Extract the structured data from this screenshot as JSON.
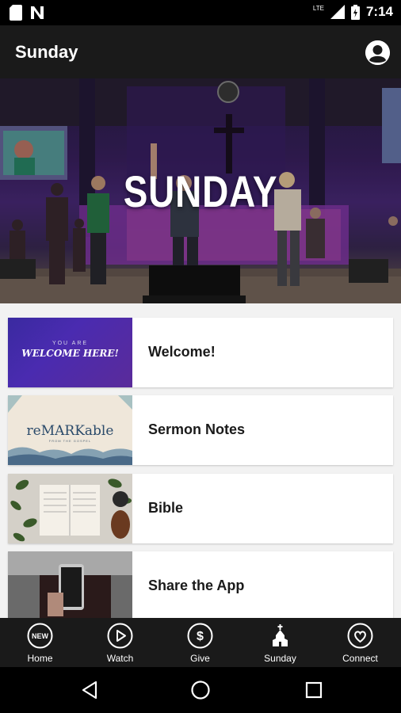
{
  "status_bar": {
    "time": "7:14",
    "network": "LTE",
    "icons": [
      "sd-card-icon",
      "n-logo-icon",
      "signal-icon",
      "battery-icon"
    ]
  },
  "app_bar": {
    "title": "Sunday",
    "profile_icon": "account-circle-icon"
  },
  "hero": {
    "title": "SUNDAY"
  },
  "cards": [
    {
      "label": "Welcome!",
      "thumb_line1": "YOU ARE",
      "thumb_line2": "WELCOME HERE!"
    },
    {
      "label": "Sermon Notes",
      "thumb_line1": "reMARKable",
      "thumb_line2": "FROM THE GOSPEL"
    },
    {
      "label": "Bible"
    },
    {
      "label": "Share the App"
    }
  ],
  "bottom_nav": {
    "items": [
      {
        "label": "Home",
        "icon": "new-badge-icon",
        "badge": "NEW"
      },
      {
        "label": "Watch",
        "icon": "play-circle-icon"
      },
      {
        "label": "Give",
        "icon": "dollar-circle-icon",
        "symbol": "$"
      },
      {
        "label": "Sunday",
        "icon": "church-icon"
      },
      {
        "label": "Connect",
        "icon": "heart-circle-icon"
      }
    ]
  },
  "system_nav": {
    "icons": [
      "back-icon",
      "home-icon",
      "recents-icon"
    ]
  },
  "colors": {
    "app_bar": "#1a1a1a",
    "status_bar": "#000000",
    "background": "#f2f2f2",
    "card": "#ffffff",
    "text_dark": "#1a1a1a"
  }
}
